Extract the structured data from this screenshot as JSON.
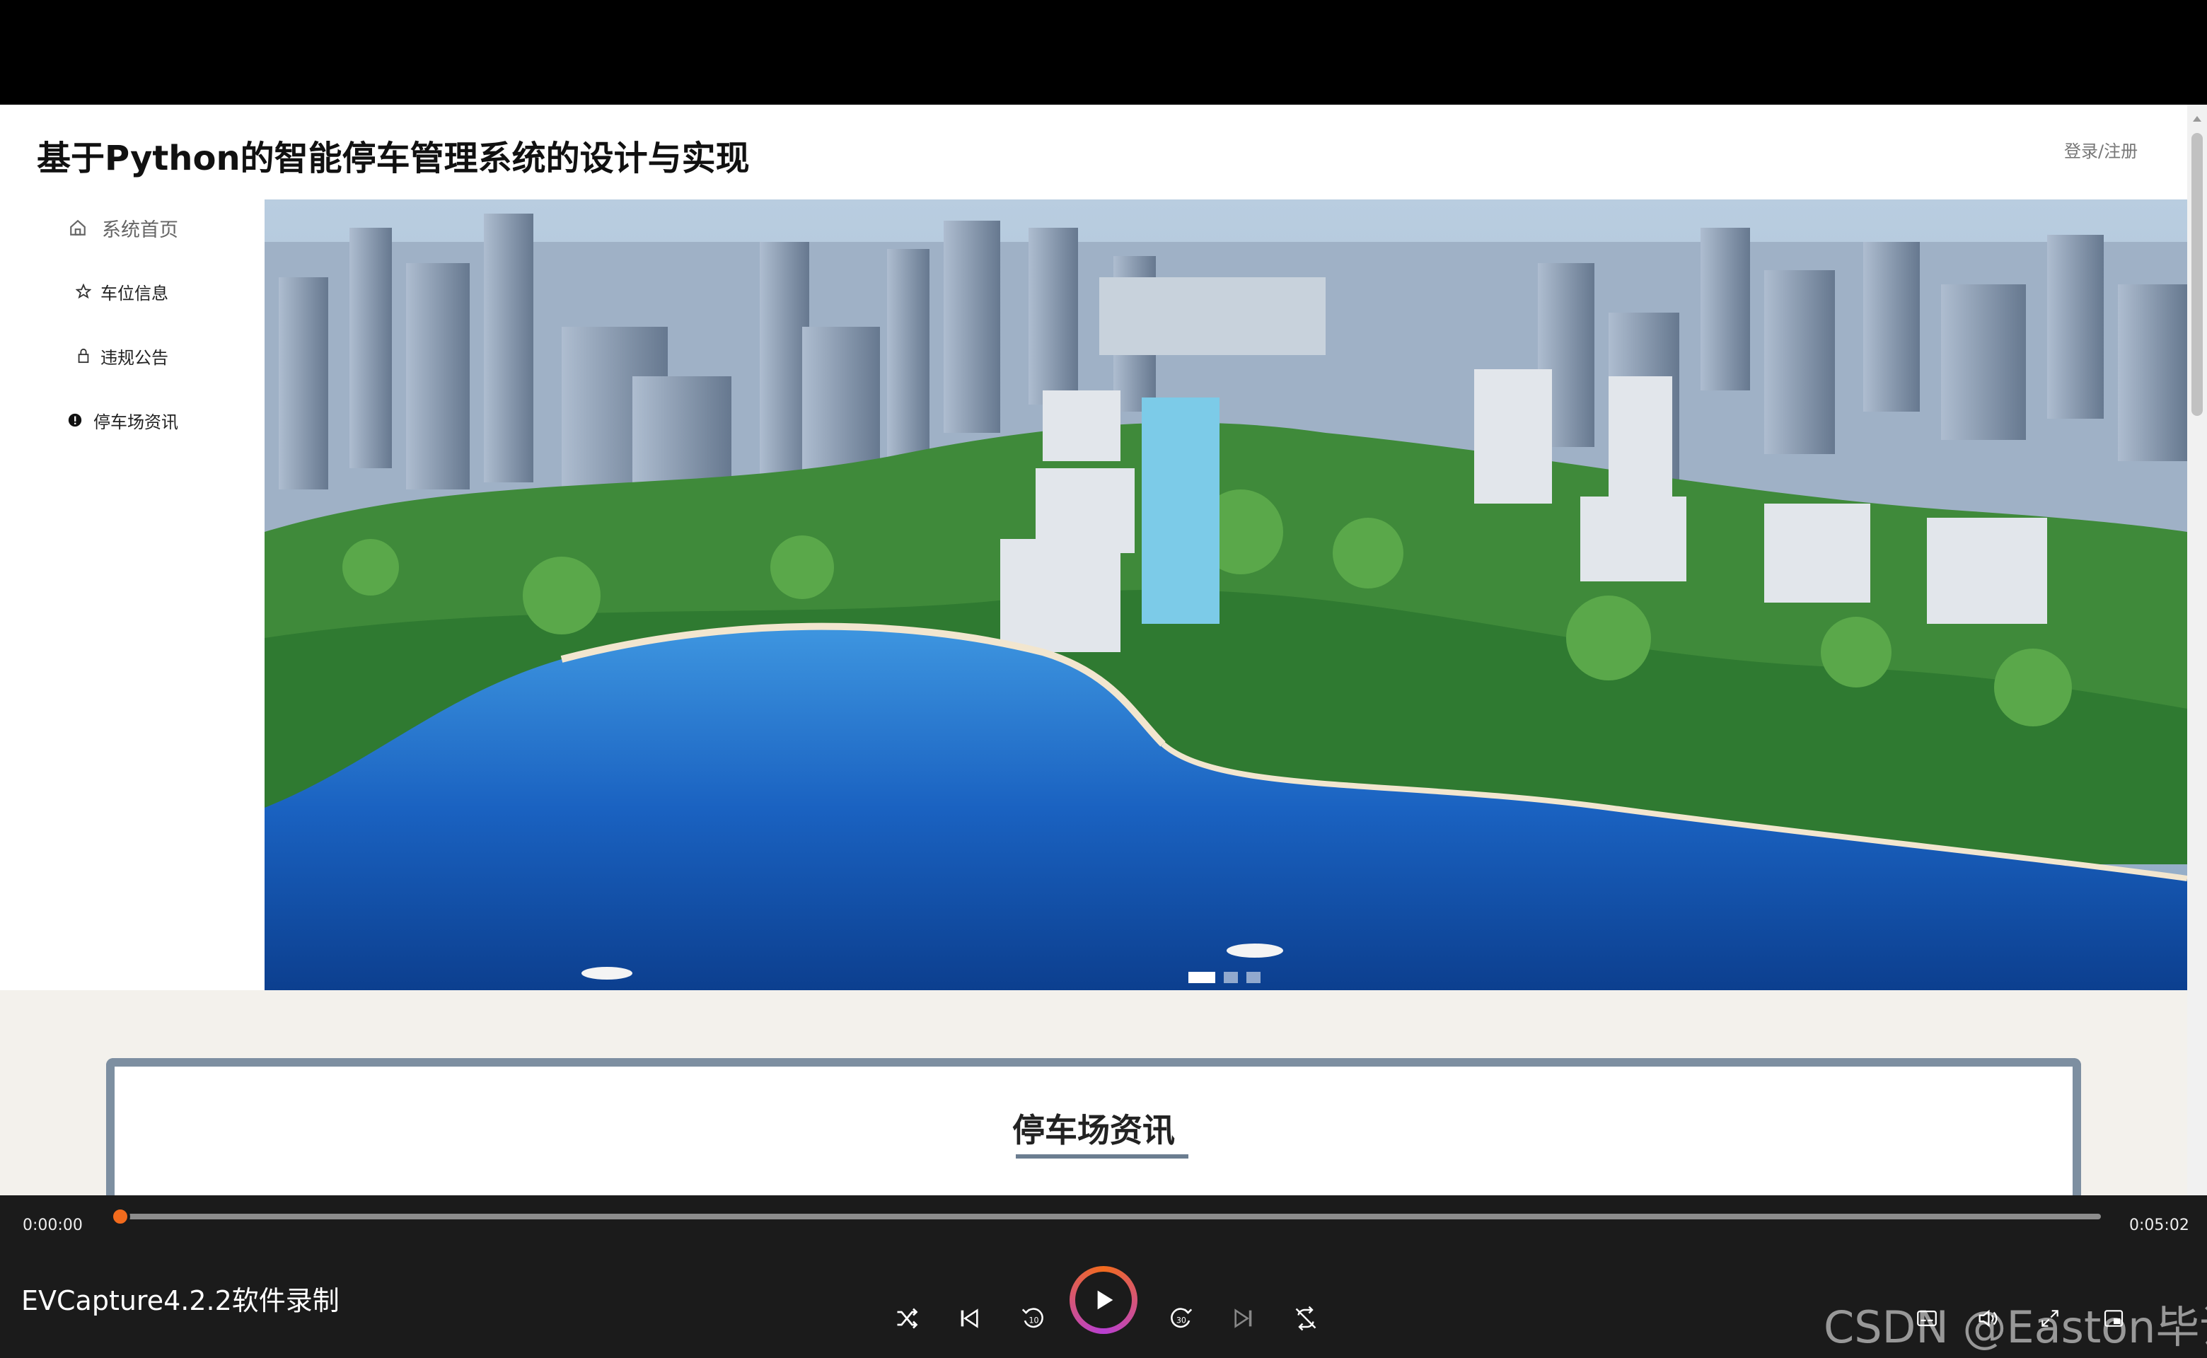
{
  "site": {
    "title": "基于Python的智能停车管理系统的设计与实现",
    "login_label": "登录/注册"
  },
  "sidebar": {
    "items": [
      {
        "label": "系统首页",
        "icon": "home-icon",
        "active": true
      },
      {
        "label": "车位信息",
        "icon": "star-icon",
        "active": false
      },
      {
        "label": "违规公告",
        "icon": "lock-icon",
        "active": false
      },
      {
        "label": "停车场资讯",
        "icon": "info-icon",
        "active": false
      }
    ]
  },
  "banner": {
    "image": "aerial waterfront city rendering",
    "slides": 3,
    "active_slide": 1
  },
  "news": {
    "title": "停车场资讯"
  },
  "player": {
    "current_time": "0:00:00",
    "total_time": "0:05:02",
    "progress": 0.0,
    "app_caption": "EVCapture4.2.2软件录制",
    "watermark": "CSDN @Easton毕设",
    "accent_color": "#f26b1d"
  }
}
